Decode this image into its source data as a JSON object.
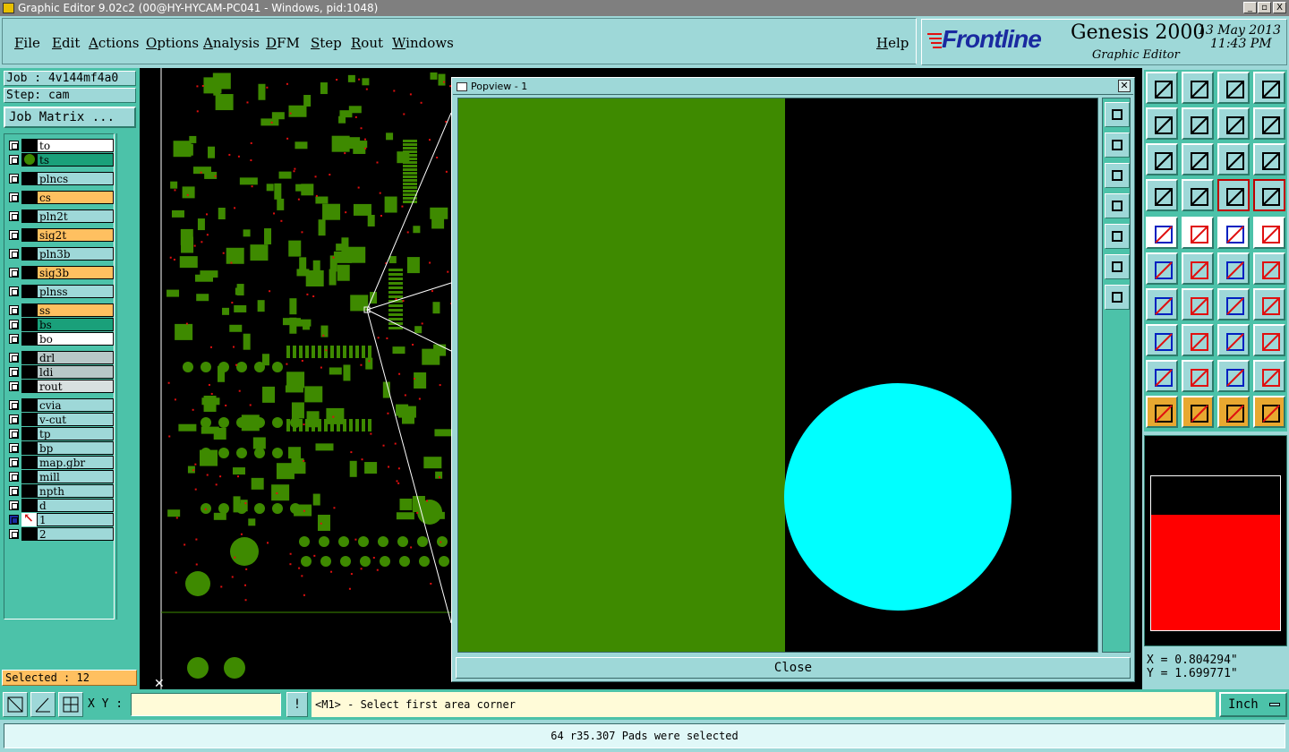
{
  "window": {
    "title": "Graphic Editor 9.02c2 (00@HY-HYCAM-PC041 - Windows, pid:1048)",
    "controls": [
      "_",
      "▫",
      "X"
    ]
  },
  "menu": {
    "items": [
      "File",
      "Edit",
      "Actions",
      "Options",
      "Analysis",
      "DFM",
      "Step",
      "Rout",
      "Windows"
    ],
    "help": "Help"
  },
  "brand": {
    "logo": "Frontline",
    "product": "Genesis 2000",
    "subtitle": "Graphic Editor",
    "date": "13 May 2013",
    "time": "11:43 PM"
  },
  "job": {
    "job_label": "Job : 4v144mf4a0",
    "step_label": "Step: cam",
    "matrix_button": "Job Matrix ..."
  },
  "layers": [
    {
      "name": "to",
      "color": "#ffffff"
    },
    {
      "name": "ts",
      "color": "#1aa07a",
      "active": true
    },
    {
      "name": "plncs",
      "color": "#9ed8d8"
    },
    {
      "name": "cs",
      "color": "#ffc060"
    },
    {
      "name": "pln2t",
      "color": "#9ed8d8"
    },
    {
      "name": "sig2t",
      "color": "#ffc060"
    },
    {
      "name": "pln3b",
      "color": "#9ed8d8"
    },
    {
      "name": "sig3b",
      "color": "#ffc060"
    },
    {
      "name": "plnss",
      "color": "#9ed8d8"
    },
    {
      "name": "ss",
      "color": "#ffc060"
    },
    {
      "name": "bs",
      "color": "#1aa07a"
    },
    {
      "name": "bo",
      "color": "#ffffff"
    },
    {
      "name": "drl",
      "color": "#b8c8c8"
    },
    {
      "name": "ldi",
      "color": "#b8c8c8"
    },
    {
      "name": "rout",
      "color": "#d8e0e0"
    },
    {
      "name": "cvia",
      "color": "#9ed8d8"
    },
    {
      "name": "v-cut",
      "color": "#9ed8d8"
    },
    {
      "name": "tp",
      "color": "#9ed8d8"
    },
    {
      "name": "bp",
      "color": "#9ed8d8"
    },
    {
      "name": "map.gbr",
      "color": "#9ed8d8"
    },
    {
      "name": "mill",
      "color": "#9ed8d8"
    },
    {
      "name": "npth",
      "color": "#9ed8d8"
    },
    {
      "name": "d",
      "color": "#9ed8d8"
    },
    {
      "name": "1",
      "color": "#9ed8d8",
      "work": true
    },
    {
      "name": "2",
      "color": "#9ed8d8"
    }
  ],
  "selected": "Selected : 12",
  "popview": {
    "title": "Popview - 1",
    "close_label": "Close",
    "pad_color": "#00ffff",
    "copper_color": "#3e8a00"
  },
  "coords": {
    "x": "X = 0.804294\"",
    "y": "Y = 1.699771\""
  },
  "command": {
    "xy_label": "X Y :",
    "xy_value": "",
    "prompt_button": "!",
    "prompt": "<M1> - Select first area corner",
    "units": "Inch"
  },
  "status": "64 r35.307 Pads were selected"
}
